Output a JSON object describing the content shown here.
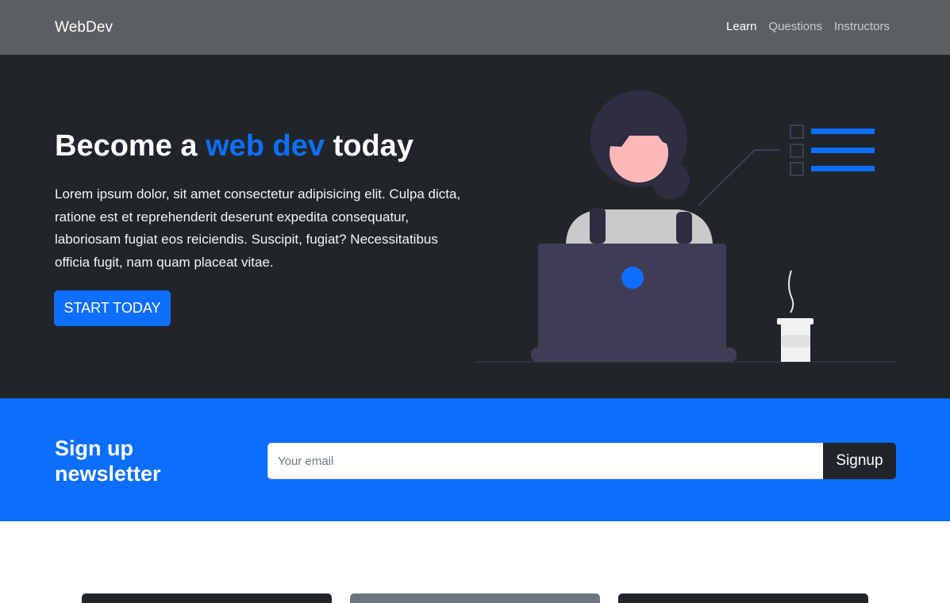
{
  "navbar": {
    "brand": "WebDev",
    "links": [
      {
        "label": "Learn",
        "active": true
      },
      {
        "label": "Questions",
        "active": false
      },
      {
        "label": "Instructors",
        "active": false
      }
    ]
  },
  "hero": {
    "title_prefix": "Become a ",
    "title_accent": "web dev",
    "title_suffix": " today",
    "body": "Lorem ipsum dolor, sit amet consectetur adipisicing elit. Culpa dicta, ratione est et reprehenderit deserunt expedita consequatur, laboriosam fugiat eos reiciendis. Suscipit, fugiat? Necessitatibus officia fugit, nam quam placeat vitae.",
    "button_label": "START TODAY",
    "illustration_icon": "woman-with-laptop-illustration"
  },
  "newsletter": {
    "title_line1": "Sign up",
    "title_line2": "newsletter",
    "email_placeholder": "Your email",
    "email_value": "",
    "button_label": "Signup"
  },
  "colors": {
    "navbar": "#5c5f62",
    "hero_background": "#212529",
    "accent": "#0d6efd",
    "newsletter_background": "#0d6efd",
    "card_dark": "#212529",
    "card_gray": "#6c757d"
  }
}
